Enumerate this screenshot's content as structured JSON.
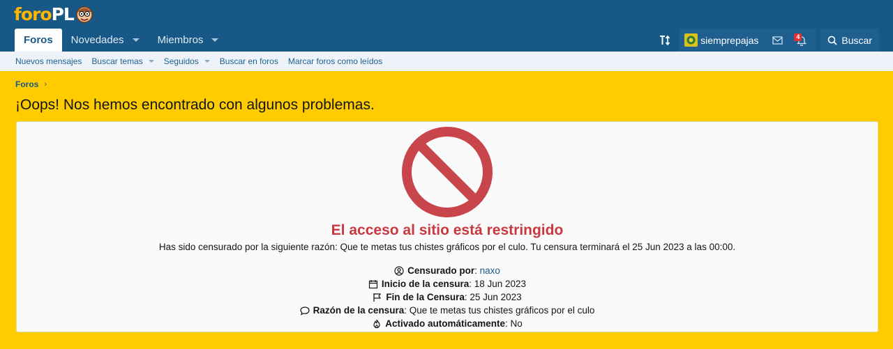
{
  "logo": {
    "text_part1": "foro",
    "text_part2": "PL"
  },
  "nav": {
    "tabs": [
      {
        "label": "Foros",
        "active": true
      },
      {
        "label": "Novedades",
        "has_dropdown": true
      },
      {
        "label": "Miembros",
        "has_dropdown": true
      }
    ]
  },
  "user": {
    "name": "siemprepajas",
    "alert_count": "4",
    "search_label": "Buscar"
  },
  "subnav": {
    "items": [
      {
        "label": "Nuevos mensajes"
      },
      {
        "label": "Buscar temas",
        "has_dropdown": true
      },
      {
        "label": "Seguidos",
        "has_dropdown": true
      },
      {
        "label": "Buscar en foros"
      },
      {
        "label": "Marcar foros como leídos"
      }
    ]
  },
  "breadcrumb": {
    "label": "Foros"
  },
  "page": {
    "title": "¡Oops! Nos hemos encontrado con algunos problemas."
  },
  "ban": {
    "title": "El acceso al sitio está restringido",
    "reason_text": "Has sido censurado por la siguiente razón: Que te metas tus chistes gráficos por el culo. Tu censura terminará el 25 Jun 2023 a las 00:00.",
    "details": {
      "banned_by_label": "Censurado por",
      "banned_by_value": "naxo",
      "start_label": "Inicio de la censura",
      "start_value": "18 Jun 2023",
      "end_label": "Fin de la Censura",
      "end_value": "25 Jun 2023",
      "reason_label": "Razón de la censura",
      "reason_value": "Que te metas tus chistes gráficos por el culo",
      "auto_label": "Activado automáticamente",
      "auto_value": "No"
    }
  },
  "colors": {
    "header_bg": "#185886",
    "page_bg": "#ffcc00",
    "ban_red": "#c8383f",
    "link": "#185886"
  },
  "icons": [
    "ban-icon",
    "user-circle-icon",
    "calendar-icon",
    "flag-icon",
    "comment-icon",
    "fire-icon",
    "search-icon",
    "mail-icon",
    "bell-icon",
    "text-size-icon"
  ]
}
